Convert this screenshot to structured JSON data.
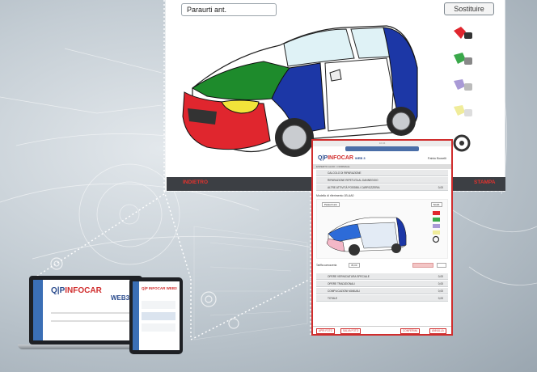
{
  "app": {
    "part_field_value": "Paraurti ant.",
    "replace_label": "Sostituire",
    "back_label": "INDIETRO",
    "print_label": "STAMPA",
    "accent": "#e3332e",
    "footer_bg": "#3c3f44"
  },
  "tablet": {
    "status": "10:34",
    "logo_prefix": "Q|P",
    "logo_brand": "INFOCAR",
    "logo_suffix": "WEB 3",
    "user": "Fabio Bonelli",
    "crumb": "ESPERTO ALDO > NORMALE",
    "rows": [
      {
        "label": "CALCOLO DI RIPARAZIONE",
        "value": ""
      },
      {
        "label": "RIPARAZIONE RIPETUTA AL DANNEGGIO",
        "value": ""
      },
      {
        "label": "ALTRE ATTIVITÀ POSSIBILI CARROZZERIA",
        "value": "0,00"
      }
    ],
    "subtitle": "Modello di riferimento 1B-AA0",
    "part_field": "Paraurti ant.",
    "replace_label": "Sostit.",
    "form_label": "Tariffa carrozzeria",
    "form_value": "35,00",
    "bottom_rows": [
      {
        "label": "OPERE VERNICIATURA SPECIALE",
        "value": "0,00"
      },
      {
        "label": "OPERE TRADIZIONALI",
        "value": "0,00"
      },
      {
        "label": "COMPLICAZIONI MANUALI",
        "value": "0,00"
      },
      {
        "label": "TOTALE",
        "value": "0,00"
      }
    ],
    "footer_buttons": [
      "APRI FOTO",
      "SALVA FOTO",
      "CONFERMA",
      "ANNULLA"
    ]
  },
  "devices": {
    "laptop_logo_prefix": "Q|P",
    "laptop_logo_brand": "INFOCAR",
    "laptop_logo_suffix": "WEB3",
    "tablet_logo": "Q|P INFOCAR WEB3"
  }
}
